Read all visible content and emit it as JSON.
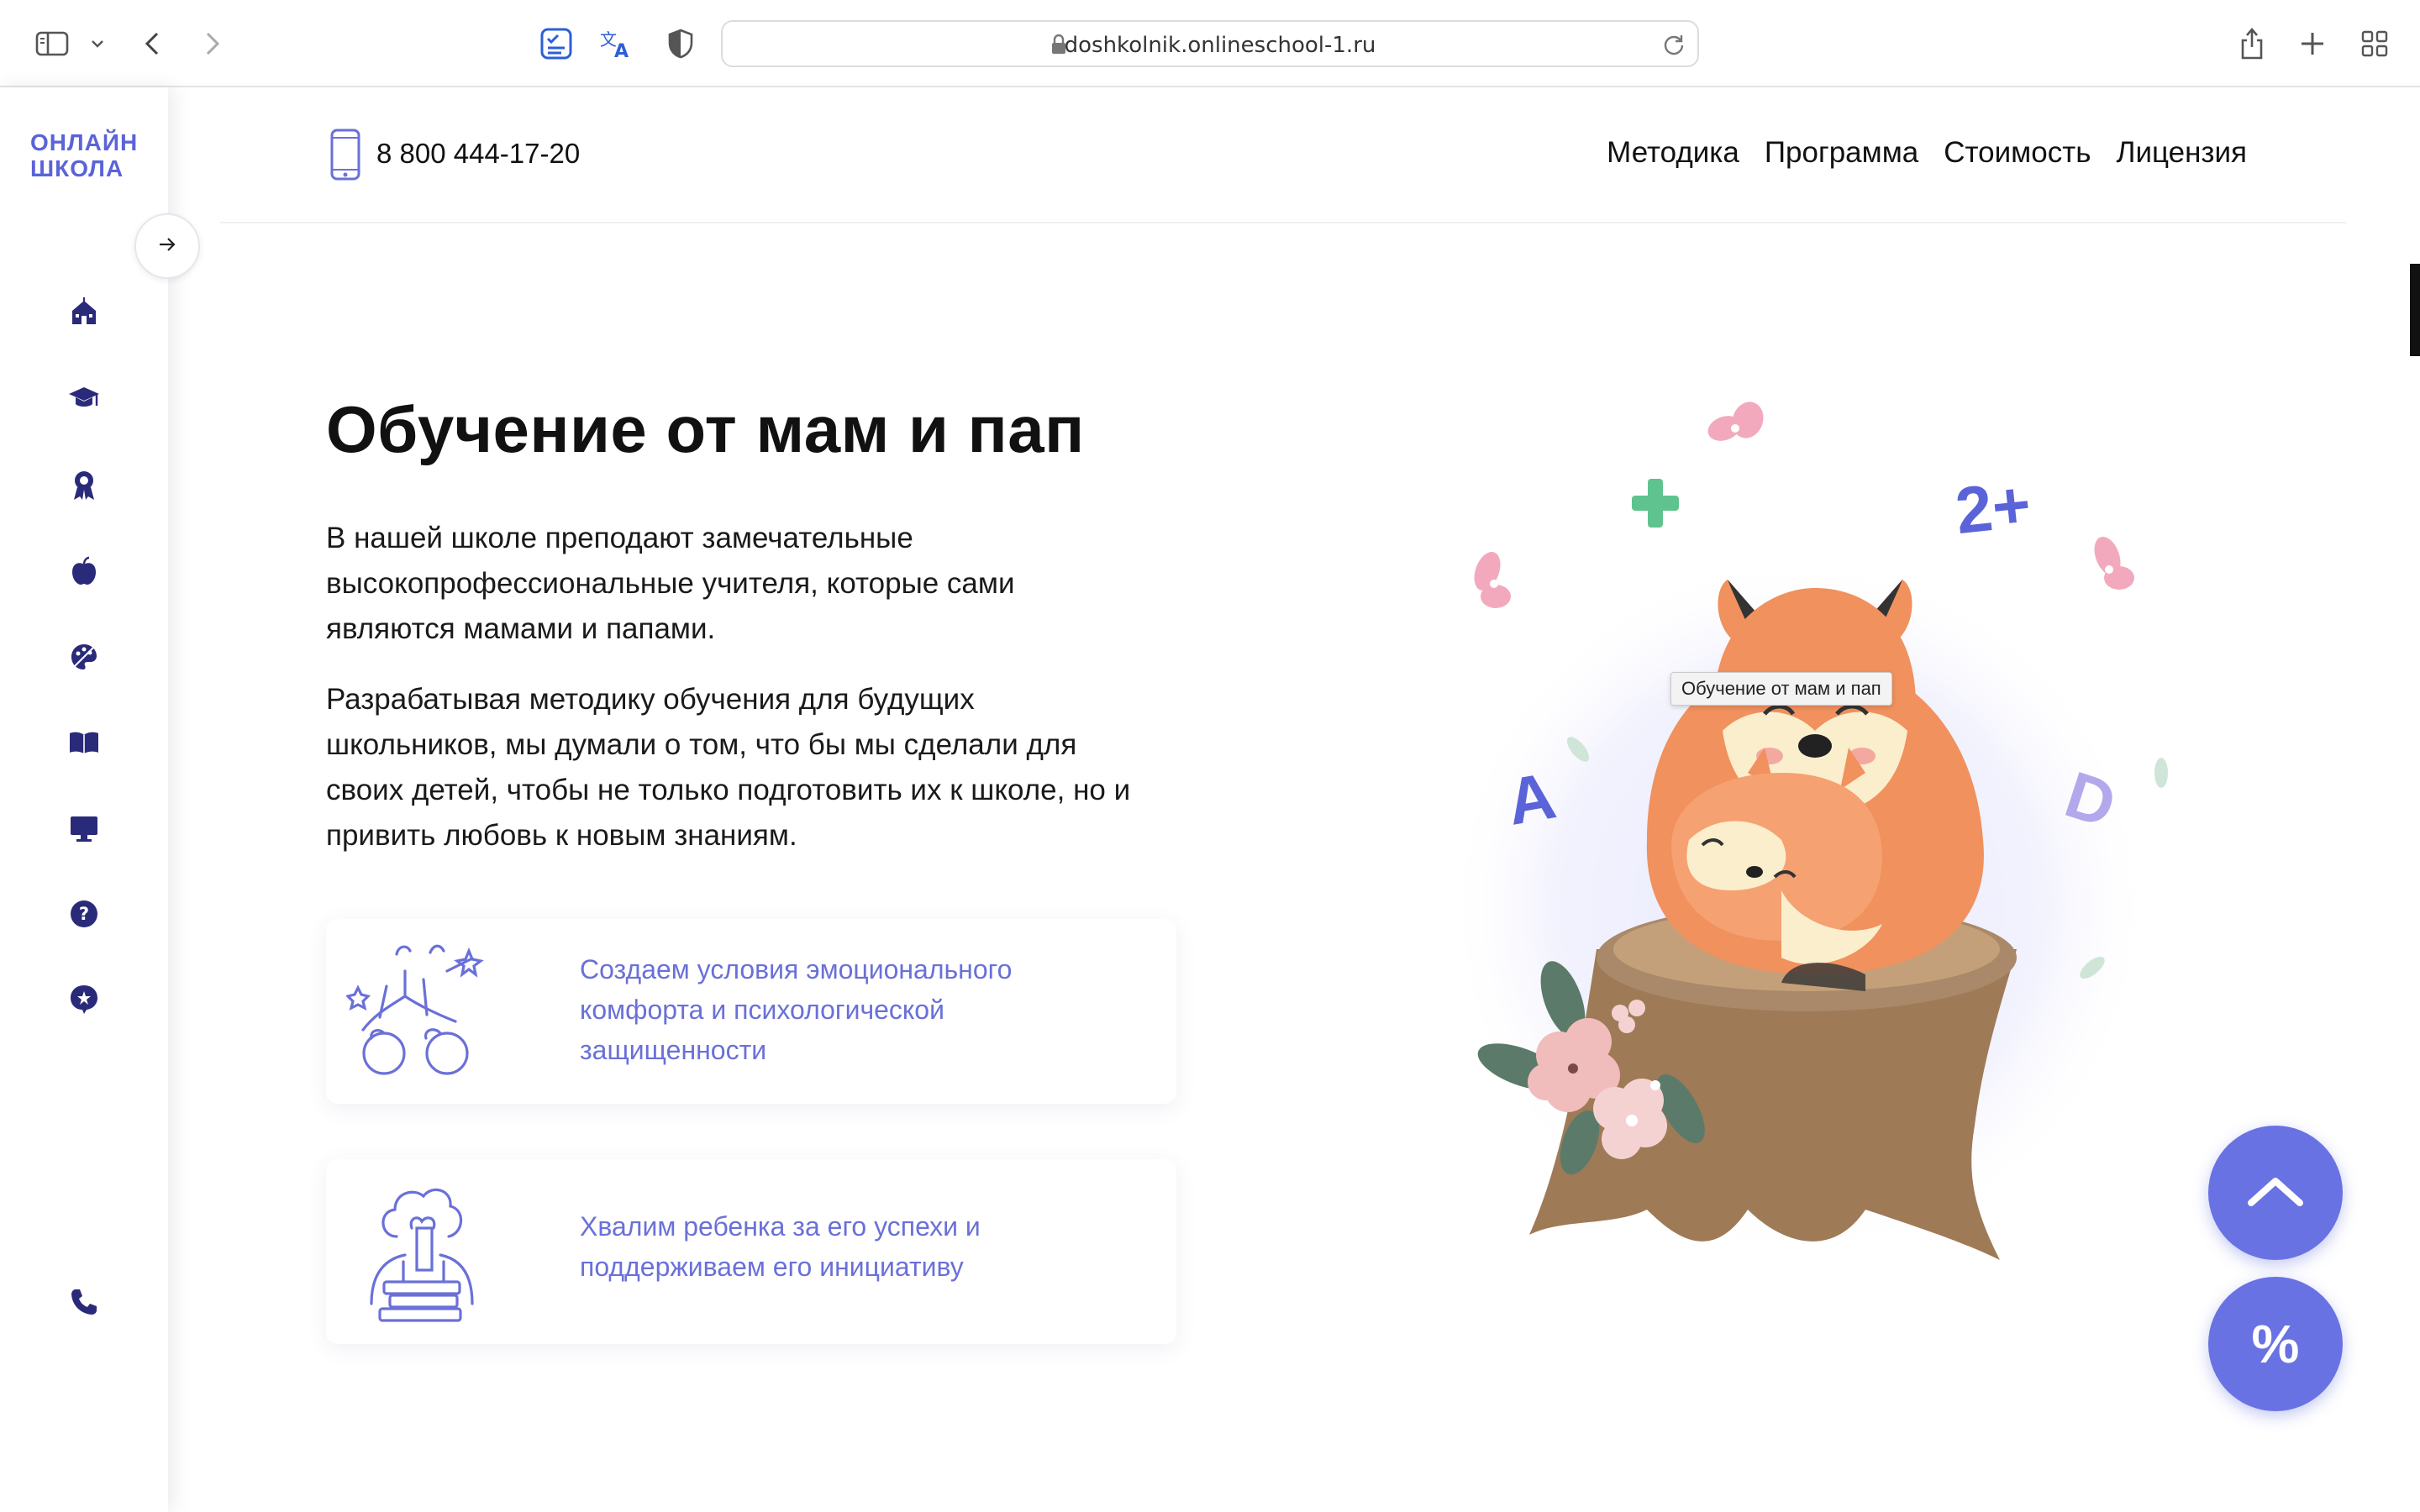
{
  "browser": {
    "url": "doshkolnik.onlineschool-1.ru"
  },
  "sidebar": {
    "logo_line1": "ОНЛАЙН",
    "logo_line2": "ШКОЛА",
    "items": [
      {
        "icon": "school-building-icon"
      },
      {
        "icon": "graduation-cap-icon"
      },
      {
        "icon": "award-ribbon-icon"
      },
      {
        "icon": "apple-icon"
      },
      {
        "icon": "palette-icon"
      },
      {
        "icon": "open-book-icon"
      },
      {
        "icon": "monitor-icon"
      },
      {
        "icon": "question-icon"
      },
      {
        "icon": "star-chat-icon"
      }
    ],
    "phone_icon": "phone-icon"
  },
  "header": {
    "phone": "8 800 444-17-20",
    "nav": [
      "Методика",
      "Программа",
      "Стоимость",
      "Лицензия"
    ]
  },
  "main": {
    "title": "Обучение от мам и пап",
    "paragraph1": "В нашей школе преподают замечательные высокопрофессиональные учителя, которые сами являются мамами и папами.",
    "paragraph2": "Разрабатывая методику обучения для будущих школьников, мы думали о том, что бы мы сделали для своих детей, чтобы не только подготовить их к школе, но и привить любовь к новым знаниям.",
    "cards": [
      {
        "text": "Создаем условия эмоционального комфорта и психологической защищенности"
      },
      {
        "text": "Хвалим ребенка за его успехи и поддерживаем его инициативу"
      }
    ],
    "tooltip": "Обучение от мам и пап",
    "illustration_letters": {
      "a": "A",
      "d": "D",
      "two_plus": "2+",
      "plus": "+"
    }
  },
  "fab": {
    "percent_label": "%"
  },
  "colors": {
    "accent": "#6872e3",
    "logo": "#5b63d8",
    "card_text": "#6a70d8",
    "sidebar_icon": "#2a2a7a"
  }
}
